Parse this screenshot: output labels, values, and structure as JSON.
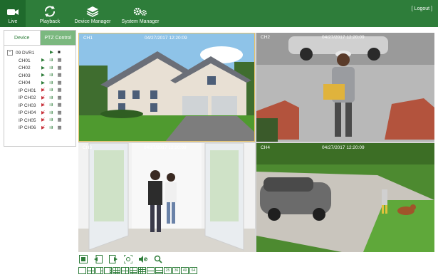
{
  "topbar": {
    "nav": [
      {
        "label": "Live",
        "icon": "camera-icon"
      },
      {
        "label": "Playback",
        "icon": "refresh-icon"
      },
      {
        "label": "Device Manager",
        "icon": "layers-icon"
      },
      {
        "label": "System Manager",
        "icon": "gears-icon"
      }
    ],
    "logout_label": "[ Logout ]"
  },
  "leftpanel": {
    "tabs": [
      "Device",
      "PTZ Control"
    ],
    "dvr_label": "09 DVR1",
    "channels": [
      "CH01",
      "CH02",
      "CH03",
      "CH04",
      "IP CH01",
      "IP CH02",
      "IP CH03",
      "IP CH04",
      "IP CH05",
      "IP CH06"
    ]
  },
  "cameras": [
    {
      "label": "CH1",
      "timestamp": "04/27/2017 12:20:09"
    },
    {
      "label": "CH2",
      "timestamp": "04/27/2017 12:20:09"
    },
    {
      "label": "CH3",
      "timestamp": "04/27/2017 12:20:09"
    },
    {
      "label": "CH4",
      "timestamp": "04/27/2017 12:20:09"
    }
  ],
  "layoutbar": {
    "labels": [
      "25",
      "36",
      "49",
      "64"
    ]
  },
  "colors": {
    "accent": "#2e7d3a",
    "selected_border": "#e6c36a"
  }
}
